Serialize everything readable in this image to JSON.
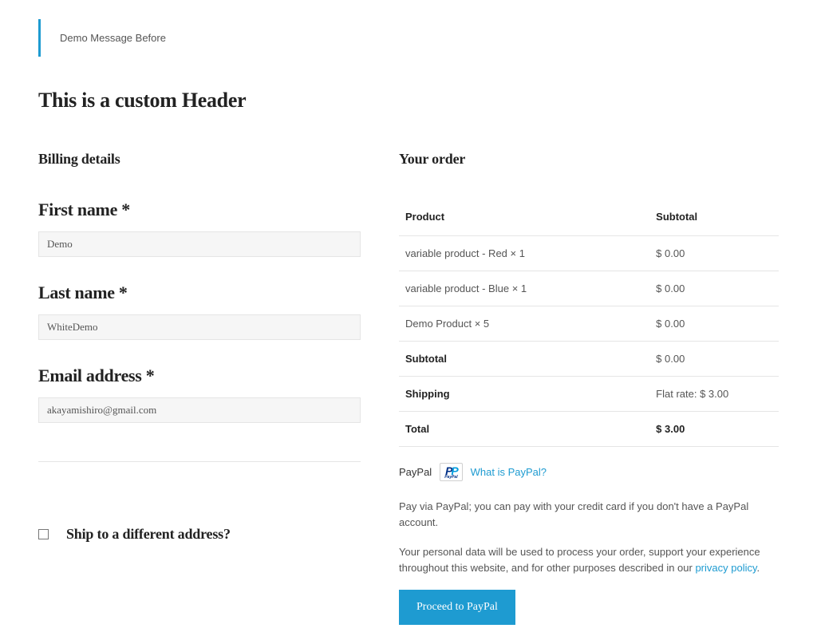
{
  "alert": "Demo Message Before",
  "header": "This is a custom Header",
  "billing": {
    "title": "Billing details",
    "first_name": {
      "label": "First name",
      "required": "*",
      "value": "Demo"
    },
    "last_name": {
      "label": "Last name",
      "required": "*",
      "value": "WhiteDemo"
    },
    "email": {
      "label": "Email address",
      "required": "*",
      "value": "akayamishiro@gmail.com"
    }
  },
  "ship_diff": {
    "label": "Ship to a different address?"
  },
  "order": {
    "title": "Your order",
    "columns": {
      "product": "Product",
      "subtotal": "Subtotal"
    },
    "items": [
      {
        "name": "variable product - Red",
        "qty": "× 1",
        "price": "$ 0.00"
      },
      {
        "name": "variable product - Blue",
        "qty": "× 1",
        "price": "$ 0.00"
      },
      {
        "name": "Demo Product",
        "qty": "× 5",
        "price": "$ 0.00"
      }
    ],
    "subtotal": {
      "label": "Subtotal",
      "value": "$ 0.00"
    },
    "shipping": {
      "label": "Shipping",
      "value": "Flat rate: $ 3.00"
    },
    "total": {
      "label": "Total",
      "value": "$ 3.00"
    }
  },
  "payment": {
    "method": "PayPal",
    "what_link": "What is PayPal?",
    "desc": "Pay via PayPal; you can pay with your credit card if you don't have a PayPal account.",
    "privacy_prefix": "Your personal data will be used to process your order, support your experience throughout this website, and for other purposes described in our ",
    "privacy_link": "privacy policy",
    "privacy_suffix": ".",
    "button": "Proceed to PayPal"
  }
}
